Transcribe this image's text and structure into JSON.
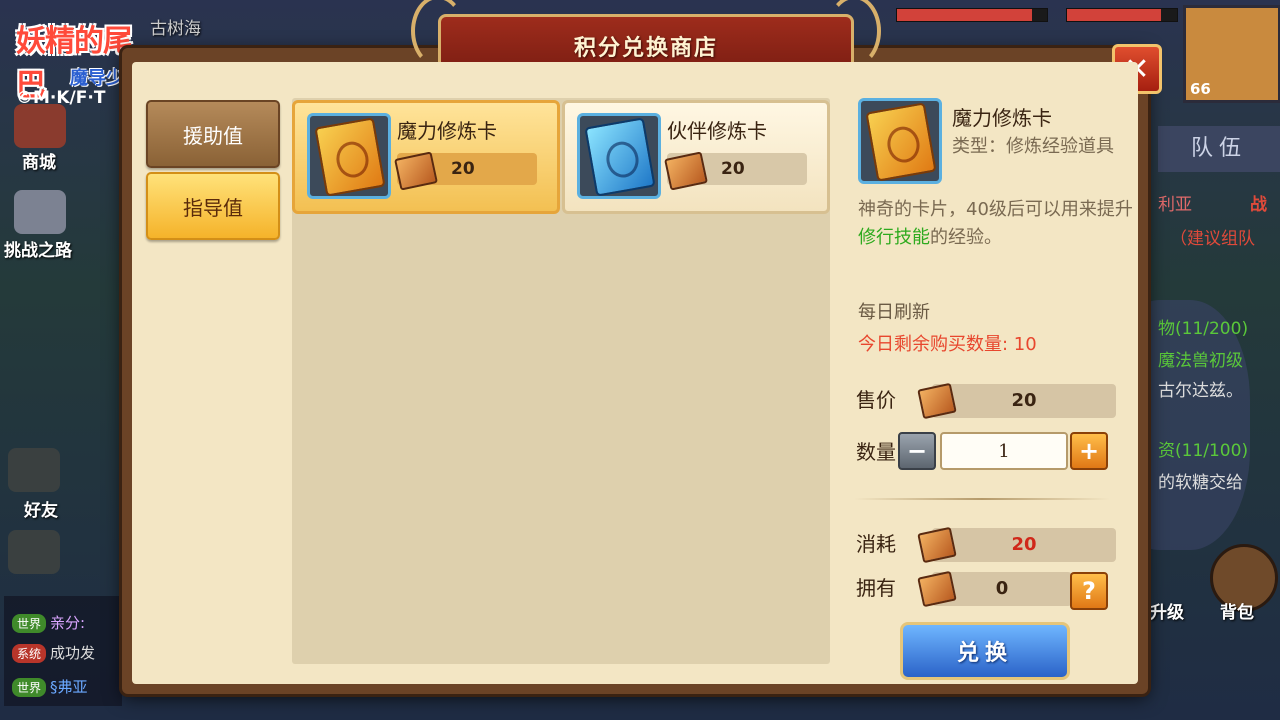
{
  "background": {
    "logo": {
      "line1": "妖精的尾巴",
      "line2": "魔导少年",
      "copyright": "©M·K/F·T"
    },
    "top_name": "古树海",
    "side_labels": {
      "shop": "商城",
      "challenge": "挑战之路",
      "friends": "好友"
    },
    "chat": [
      {
        "channel": "世界",
        "text": "亲分:"
      },
      {
        "channel": "系统",
        "text": "成功发"
      },
      {
        "channel": "世界",
        "text": "§弗亚"
      }
    ],
    "right_panel": {
      "avatar_level": "66",
      "team_tab": "队伍",
      "lines": [
        "利亚",
        "（建议组队",
        "物(11/200)",
        "魔法兽初级",
        "古尔达兹。",
        "资(11/100)",
        "的软糖交给"
      ],
      "battle_tag": "战",
      "bag_label": "背包",
      "level_label": "升级"
    }
  },
  "shop": {
    "title": "积分兑换商店",
    "tabs": [
      {
        "label": "援助值",
        "active": false
      },
      {
        "label": "指导值",
        "active": true
      }
    ],
    "items": [
      {
        "name": "魔力修炼卡",
        "price": "20",
        "card": "gold-card-icon",
        "selected": true
      },
      {
        "name": "伙伴修炼卡",
        "price": "20",
        "card": "blue-card-icon",
        "selected": false
      }
    ],
    "detail": {
      "name": "魔力修炼卡",
      "type": "类型：修炼经验道具",
      "desc_pre": "神奇的卡片，40级后可以用来提升",
      "desc_highlight": "修行技能",
      "desc_post": "的经验。",
      "refresh": "每日刷新",
      "remaining": "今日剩余购买数量: 10",
      "price_label": "售价",
      "price": "20",
      "qty_label": "数量",
      "qty": "1",
      "cost_label": "消耗",
      "cost": "20",
      "own_label": "拥有",
      "own": "0",
      "help": "?",
      "exchange": "兑换"
    },
    "colors": {
      "highlight": "#2eaa1e",
      "remaining": "#e8472e",
      "cost": "#d0281a"
    }
  }
}
